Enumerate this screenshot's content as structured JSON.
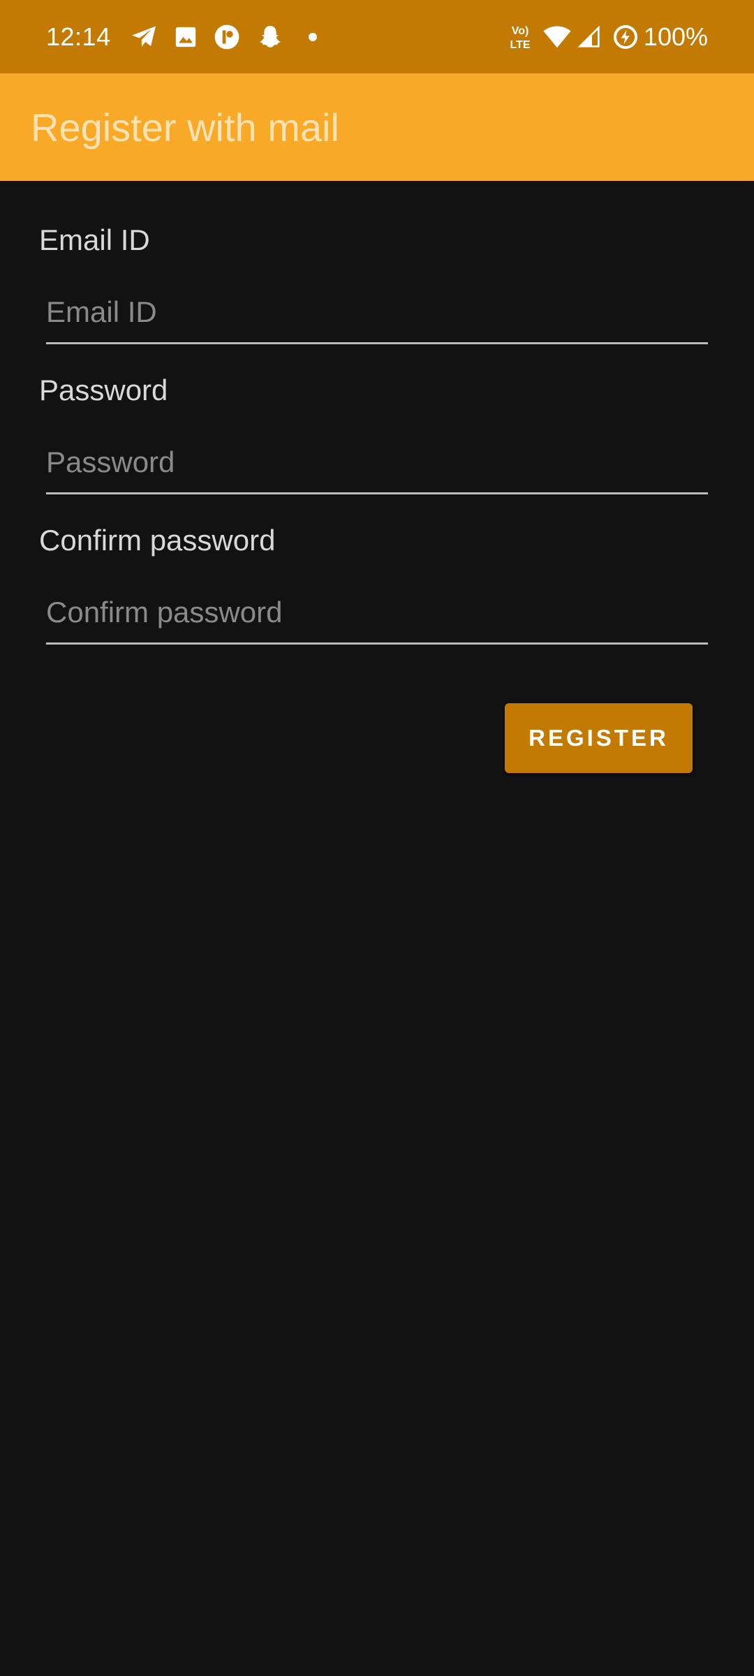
{
  "status_bar": {
    "time": "12:14",
    "battery_percent": "100%",
    "notification_icons": [
      "telegram-icon",
      "image-icon",
      "app-icon",
      "snapchat-icon",
      "dot-icon"
    ],
    "system_icons": [
      "volte-icon",
      "wifi-icon",
      "cell-signal-icon",
      "battery-saver-icon"
    ],
    "volte_text": "Vo LTE",
    "background_color": "#c37a02"
  },
  "app_bar": {
    "title": "Register with mail",
    "background_color": "#f8a928"
  },
  "form": {
    "email": {
      "label": "Email ID",
      "value": "",
      "placeholder": "Email ID"
    },
    "password": {
      "label": "Password",
      "value": "",
      "placeholder": "Password"
    },
    "confirm_password": {
      "label": "Confirm password",
      "value": "",
      "placeholder": "Confirm password"
    },
    "register_button": {
      "label": "REGISTER",
      "color": "#c37a02"
    }
  },
  "colors": {
    "background": "#121212",
    "accent": "#c37a02"
  }
}
